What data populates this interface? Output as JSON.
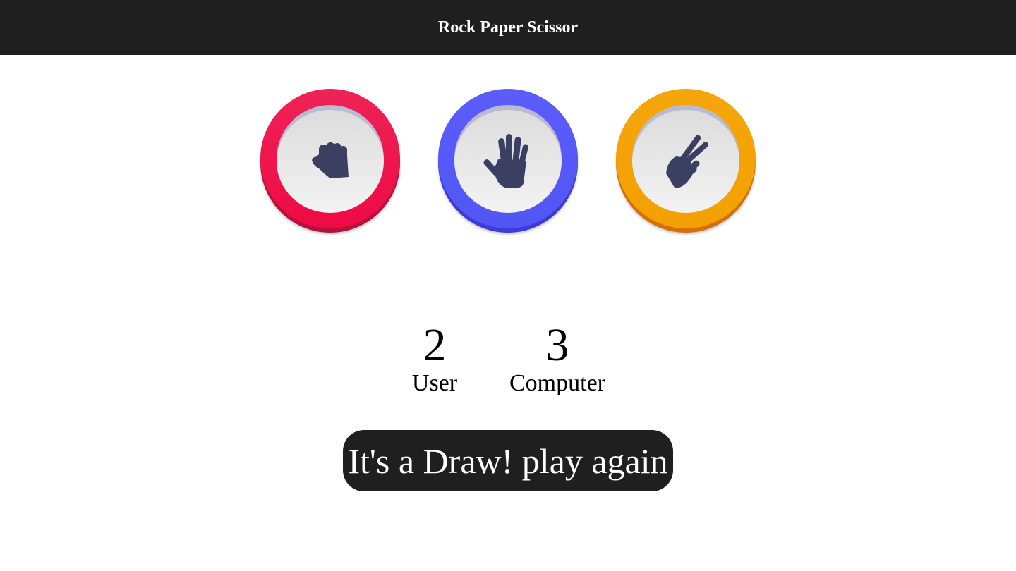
{
  "header": {
    "title": "Rock Paper Scissor"
  },
  "choices": [
    {
      "name": "rock",
      "icon": "fist-icon",
      "ring_color": "#ee0a45"
    },
    {
      "name": "paper",
      "icon": "open-hand-icon",
      "ring_color": "#5056f4"
    },
    {
      "name": "scissor",
      "icon": "peace-hand-icon",
      "ring_color": "#f4a000"
    }
  ],
  "scoreboard": {
    "user": {
      "score": "2",
      "label": "User"
    },
    "computer": {
      "score": "3",
      "label": "Computer"
    }
  },
  "result": {
    "message": "It's a Draw! play again"
  },
  "colors": {
    "navbar_bg": "#1f1f1f",
    "icon_color": "#3b4063"
  }
}
